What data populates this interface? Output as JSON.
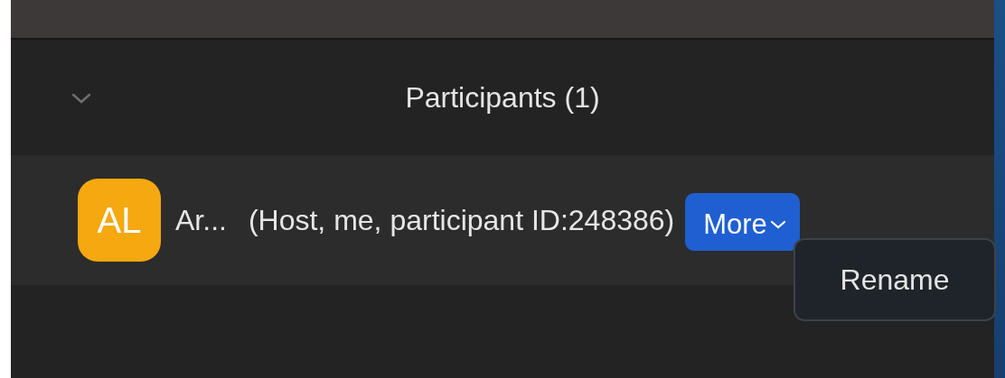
{
  "panel": {
    "title": "Participants (1)"
  },
  "participants": [
    {
      "initials": "AL",
      "name": "Ar...",
      "details": "(Host, me, participant ID:248386)",
      "button": "More"
    }
  ],
  "menu": {
    "items": [
      "Rename"
    ]
  }
}
